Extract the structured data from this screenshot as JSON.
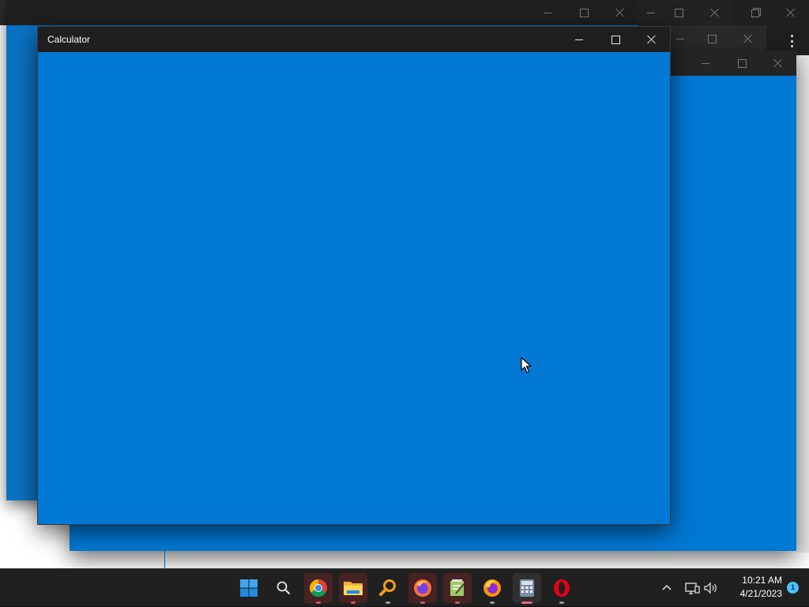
{
  "main_window": {
    "title": "Calculator",
    "controls": {
      "minimize": "minimize",
      "maximize": "maximize",
      "close": "close"
    }
  },
  "taskbar": {
    "apps": [
      {
        "name": "start",
        "icon": "windows-logo-icon",
        "state": "none"
      },
      {
        "name": "search",
        "icon": "search-icon",
        "state": "none"
      },
      {
        "name": "chrome",
        "icon": "chrome-icon",
        "state": "alert"
      },
      {
        "name": "file-explorer",
        "icon": "folder-icon",
        "state": "alert"
      },
      {
        "name": "search-everything",
        "icon": "magnifier-orange-icon",
        "state": "running"
      },
      {
        "name": "firefox",
        "icon": "firefox-icon",
        "state": "alert"
      },
      {
        "name": "notepad-plus",
        "icon": "notepad-icon",
        "state": "alert"
      },
      {
        "name": "firefox-dev",
        "icon": "firefox-icon",
        "state": "running"
      },
      {
        "name": "calculator",
        "icon": "calculator-icon",
        "state": "active"
      },
      {
        "name": "opera",
        "icon": "opera-icon",
        "state": "running"
      }
    ],
    "tray": {
      "time": "10:21 AM",
      "date": "4/21/2023",
      "notification_count": "1"
    }
  },
  "colors": {
    "client_blue": "#0078d4",
    "titlebar": "#1f1f1f",
    "taskbar": "#202020",
    "accent": "#4cc2ff"
  }
}
